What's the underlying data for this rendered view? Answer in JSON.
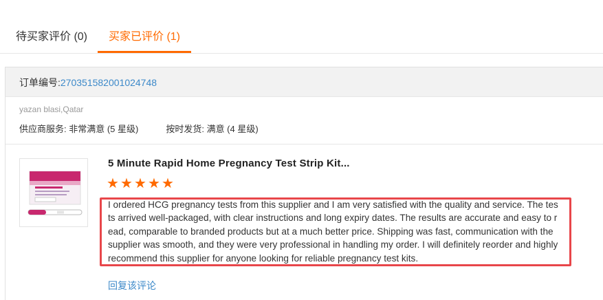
{
  "tabs": [
    {
      "label": "待买家评价 (0)"
    },
    {
      "label": "买家已评价 (1)"
    }
  ],
  "order": {
    "label": "订单编号:",
    "number": "270351582001024748"
  },
  "buyer": {
    "name": "yazan blasi,Qatar"
  },
  "ratings": {
    "supplier_service": "供应商服务: 非常满意 (5 星级)",
    "on_time_shipping": "按时发货: 满意 (4 星级)"
  },
  "product": {
    "title": "5 Minute Rapid Home Pregnancy Test Strip Kit...",
    "stars": 5,
    "review": "I ordered HCG pregnancy tests from this supplier and I am very satisfied with the quality and service. The tests arrived well-packaged, with clear instructions and long expiry dates. The results are accurate and easy to read, comparable to branded products but at a much better price. Shipping was fast, communication with the supplier was smooth, and they were very professional in handling my order. I will definitely reorder and highly recommend this supplier for anyone looking for reliable pregnancy test kits.",
    "reply_link": "回复该评论"
  },
  "colors": {
    "accent": "#ff6a00",
    "link": "#3c89c9",
    "highlight_border": "#e8464a"
  }
}
